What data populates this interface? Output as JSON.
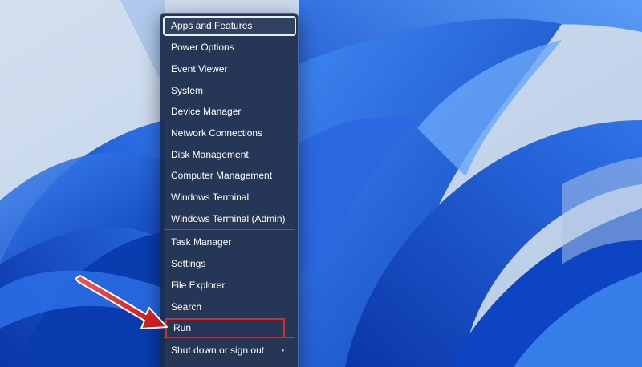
{
  "context_menu": {
    "items": [
      {
        "label": "Apps and Features"
      },
      {
        "label": "Power Options"
      },
      {
        "label": "Event Viewer"
      },
      {
        "label": "System"
      },
      {
        "label": "Device Manager"
      },
      {
        "label": "Network Connections"
      },
      {
        "label": "Disk Management"
      },
      {
        "label": "Computer Management"
      },
      {
        "label": "Windows Terminal"
      },
      {
        "label": "Windows Terminal (Admin)"
      },
      {
        "label": "Task Manager"
      },
      {
        "label": "Settings"
      },
      {
        "label": "File Explorer"
      },
      {
        "label": "Search"
      },
      {
        "label": "Run"
      },
      {
        "label": "Shut down or sign out"
      }
    ],
    "selected_item": "Apps and Features",
    "highlighted_item": "Run",
    "submenu_icon": "chevron-right-icon"
  },
  "annotation": {
    "arrow_color": "#e32424",
    "box_color": "#e32424"
  },
  "colors": {
    "menu_background": "#1c2c4c",
    "wallpaper_accent": "#1a5ad8",
    "wallpaper_background": "#c9d8ea"
  }
}
